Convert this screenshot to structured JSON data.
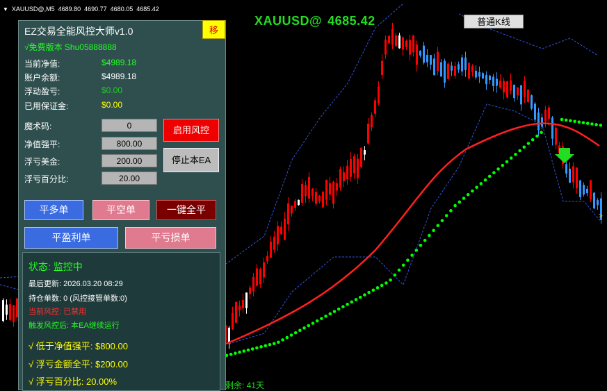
{
  "window": {
    "symbol_info": "XAUUSD@,M5",
    "ohlc": [
      "4689.80",
      "4690.77",
      "4680.05",
      "4685.42"
    ]
  },
  "header": {
    "symbol": "XAUUSD@",
    "price": "4685.42"
  },
  "kline_button": "普通K线",
  "expiry_text": "剩余: 41天",
  "axis_marker": ">",
  "panel": {
    "title": "EZ交易全能风控大师v1.0",
    "move_button": "移",
    "subtitle": "√免费版本 Shu05888888",
    "account": [
      {
        "label": "当前净值:",
        "value": "$4989.18",
        "color": "#22ff22"
      },
      {
        "label": "账户余额:",
        "value": "$4989.18",
        "color": "#ffffff"
      },
      {
        "label": "浮动盈亏:",
        "value": "$0.00",
        "color": "#22cc22"
      },
      {
        "label": "已用保证金:",
        "value": "$0.00",
        "color": "#ffff00"
      }
    ],
    "fields": [
      {
        "label": "魔术码:",
        "value": "0"
      },
      {
        "label": "净值强平:",
        "value": "800.00"
      },
      {
        "label": "浮亏美金:",
        "value": "200.00"
      },
      {
        "label": "浮亏百分比:",
        "value": "20.00"
      }
    ],
    "enable_button": "启用风控",
    "stop_button": "停止本EA",
    "buttons": {
      "close_buy": "平多单",
      "close_sell": "平空单",
      "close_all": "一键全平",
      "close_profit": "平盈利单",
      "close_loss": "平亏损单"
    },
    "status": {
      "state": "状态: 监控中",
      "last_update": "最后更新: 2026.03.20 08:29",
      "positions": "持仓单数: 0 (风控接管单数:0)",
      "risk_state": "当前风控: 已禁用",
      "after_trigger": "触发风控后: 本EA继续运行",
      "rule1": "√ 低于净值强平: $800.00",
      "rule2": "√ 浮亏金额全平: $200.00",
      "rule3": "√ 浮亏百分比: 20.00%"
    }
  },
  "colors": {
    "bull": "#ff0000",
    "bear": "#3399ff",
    "ma": "#ff2020",
    "sar": "#00ff00",
    "bands": "#3355dd"
  }
}
